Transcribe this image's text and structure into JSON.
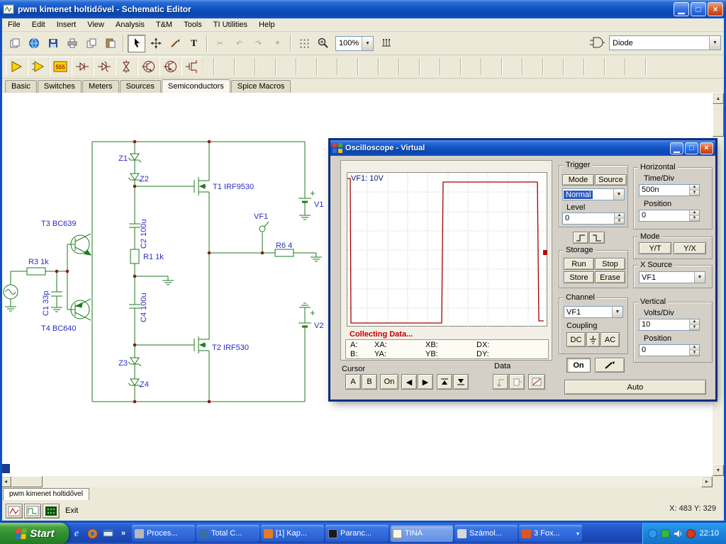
{
  "titlebar": {
    "title": "pwm kimenet holtidővel - Schematic Editor"
  },
  "menu": {
    "items": [
      "File",
      "Edit",
      "Insert",
      "View",
      "Analysis",
      "T&M",
      "Tools",
      "TI Utilities",
      "Help"
    ]
  },
  "toolbar": {
    "zoom": "100%",
    "component_combo": "Diode",
    "text_tool": "T"
  },
  "component_bar": {
    "timer_label": "555"
  },
  "tabs": {
    "items": [
      "Basic",
      "Switches",
      "Meters",
      "Sources",
      "Semiconductors",
      "Spice Macros"
    ],
    "active": "Semiconductors"
  },
  "schematic": {
    "z1": "Z1",
    "z2": "Z2",
    "z3": "Z3",
    "z4": "Z4",
    "t1": "T1 IRF9530",
    "t2": "T2 IRF530",
    "t3": "T3 BC639",
    "t4": "T4 BC640",
    "c1": "C1 33p",
    "c2": "C2 100u",
    "c4": "C4 100u",
    "r1": "R1 1k",
    "r3": "R3 1k",
    "r6": "R6 4",
    "v1": "V1",
    "v2": "V2",
    "vf1": "VF1",
    "plus": "+"
  },
  "scope": {
    "title": "Oscilloscope - Virtual",
    "screen_label": "VF1: 10V",
    "status": "Collecting Data...",
    "readouts": {
      "a": "A:",
      "xa": "XA:",
      "xb": "XB:",
      "dx": "DX:",
      "b": "B:",
      "ya": "YA:",
      "yb": "YB:",
      "dy": "DY:"
    },
    "cursor": {
      "title": "Cursor",
      "a": "A",
      "b": "B",
      "on": "On"
    },
    "data_group": {
      "title": "Data"
    },
    "trigger": {
      "title": "Trigger",
      "mode": "Mode",
      "source": "Source",
      "mode_value": "Normal",
      "level_label": "Level",
      "level_value": "0"
    },
    "storage": {
      "title": "Storage",
      "run": "Run",
      "stop": "Stop",
      "store": "Store",
      "erase": "Erase"
    },
    "channel": {
      "title": "Channel",
      "value": "VF1",
      "coupling": "Coupling",
      "dc": "DC",
      "ac": "AC",
      "on": "On"
    },
    "horizontal": {
      "title": "Horizontal",
      "timediv": "Time/Div",
      "timediv_value": "500n",
      "position": "Position",
      "position_value": "0",
      "mode": "Mode",
      "yt": "Y/T",
      "yx": "Y/X",
      "xsource": "X Source",
      "xsource_value": "VF1"
    },
    "vertical": {
      "title": "Vertical",
      "voltsdiv": "Volts/Div",
      "voltsdiv_value": "10",
      "position": "Position",
      "position_value": "0"
    },
    "auto": "Auto"
  },
  "statusbar": {
    "doc_tab": "pwm kimenet holtidővel",
    "exit": "Exit",
    "coords": "X: 483 Y: 329"
  },
  "taskbar": {
    "start": "Start",
    "tasks": [
      "Proces...",
      "Total C...",
      "[1] Kap...",
      "Paranc...",
      "TINA",
      "Számol...",
      "3 Fox..."
    ],
    "time": "22:10"
  }
}
